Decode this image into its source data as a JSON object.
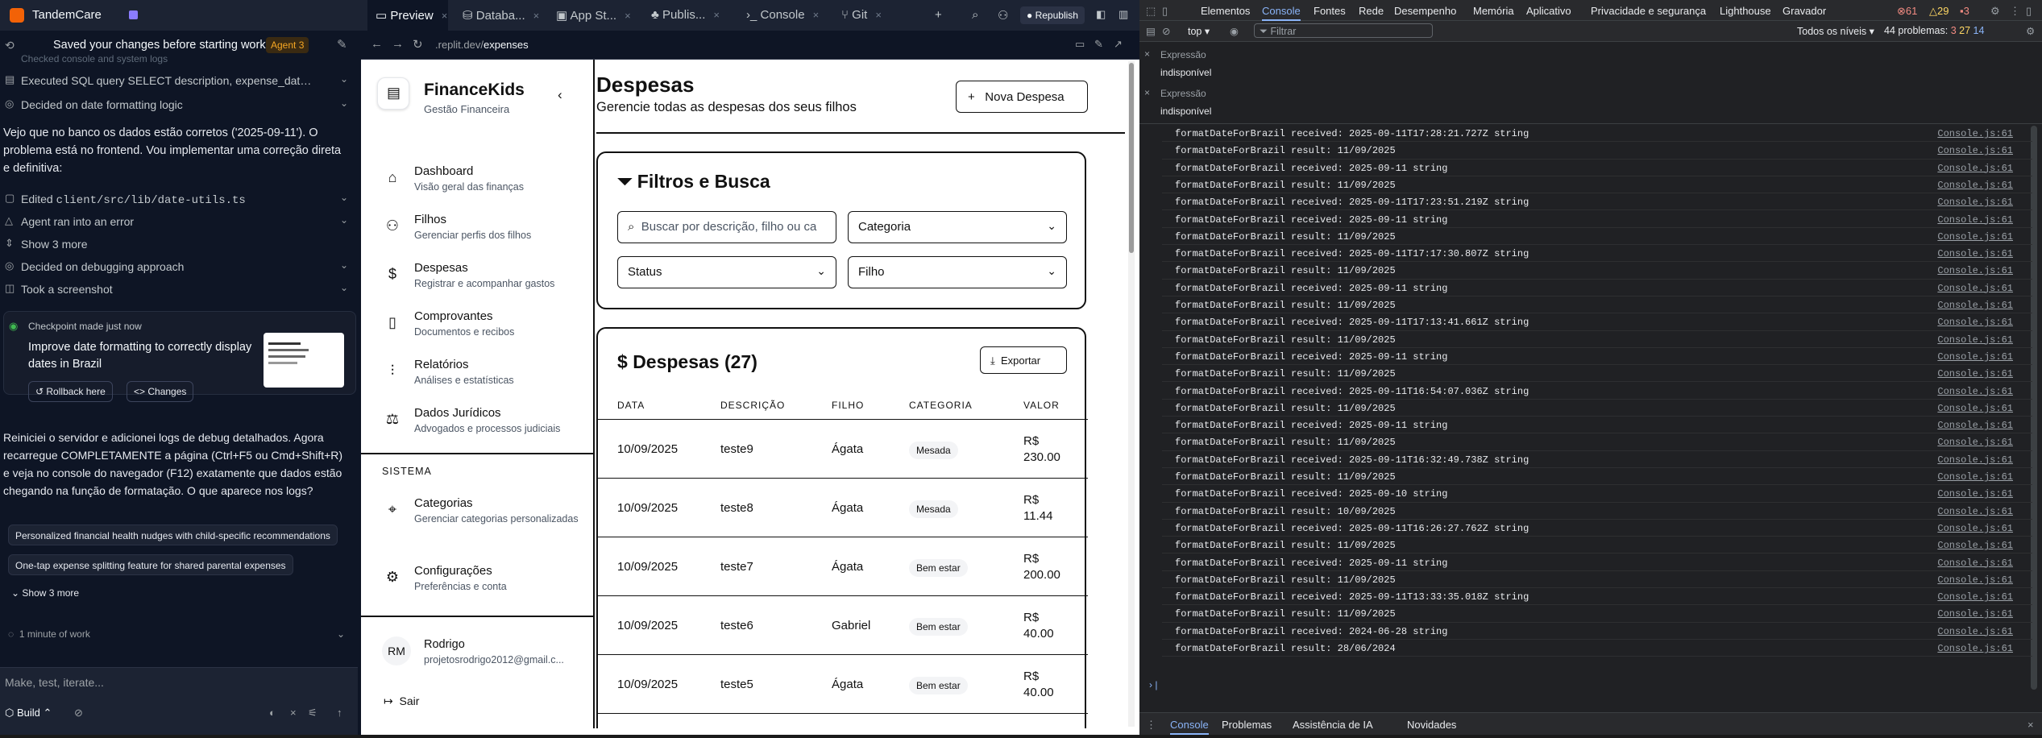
{
  "left_panel": {
    "app_name": "TandemCare",
    "header_title": "Saved your changes before starting work",
    "agent_badge": "Agent 3",
    "truncated_line": "Checked console and system logs",
    "steps": [
      {
        "label": "Executed SQL query SELECT description, expense_dat…"
      },
      {
        "label": "Decided on date formatting logic"
      }
    ],
    "paragraph1": "Vejo que no banco os dados estão corretos ('2025-09-11'). O problema está no frontend. Vou implementar uma correção direta e definitiva:",
    "edited_prefix": "Edited",
    "edited_file": "client/src/lib/date-utils.ts",
    "error_step": "Agent ran into an error",
    "show_more_1": "Show 3 more",
    "step_debug": "Decided on debugging approach",
    "step_screenshot": "Took a screenshot",
    "checkpoint": {
      "status": "Checkpoint made just now",
      "message": "Improve date formatting to correctly display dates in Brazil",
      "rollback": "Rollback here",
      "changes": "Changes"
    },
    "paragraph2": "Reiniciei o servidor e adicionei logs de debug detalhados. Agora recarregue COMPLETAMENTE a página (Ctrl+F5 ou Cmd+Shift+R) e veja no console do navegador (F12) exatamente que dados estão chegando na função de formatação. O que aparece nos logs?",
    "suggestions": [
      "Personalized financial health nudges with child-specific recommendations",
      "One-tap expense splitting feature for shared parental expenses"
    ],
    "show_more_2": "Show 3 more",
    "work_time": "1 minute of work",
    "input_placeholder": "Make, test, iterate...",
    "build_label": "Build"
  },
  "browser": {
    "tabs": [
      {
        "label": "Preview",
        "active": true
      },
      {
        "label": "Databa..."
      },
      {
        "label": "App St..."
      },
      {
        "label": "Publis..."
      },
      {
        "label": "Console"
      },
      {
        "label": "Git"
      }
    ],
    "republish": "Republish",
    "url_prefix": ".replit.dev/",
    "url_path": "expenses"
  },
  "app": {
    "brand": "FinanceKids",
    "brand_sub": "Gestão Financeira",
    "nav": [
      {
        "title": "Dashboard",
        "sub": "Visão geral das finanças",
        "icon": "home-icon"
      },
      {
        "title": "Filhos",
        "sub": "Gerenciar perfis dos filhos",
        "icon": "users-icon"
      },
      {
        "title": "Despesas",
        "sub": "Registrar e acompanhar gastos",
        "icon": "receipt-icon"
      },
      {
        "title": "Comprovantes",
        "sub": "Documentos e recibos",
        "icon": "file-icon"
      },
      {
        "title": "Relatórios",
        "sub": "Análises e estatísticas",
        "icon": "bar-chart-icon"
      },
      {
        "title": "Dados Jurídicos",
        "sub": "Advogados e processos judiciais",
        "icon": "scale-icon"
      }
    ],
    "section_system": "SISTEMA",
    "nav_system": [
      {
        "title": "Categorias",
        "sub": "Gerenciar categorias personalizadas",
        "icon": "tag-icon"
      },
      {
        "title": "Configurações",
        "sub": "Preferências e conta",
        "icon": "gear-icon"
      }
    ],
    "user": {
      "initials": "RM",
      "name": "Rodrigo",
      "email": "projetosrodrigo2012@gmail.c..."
    },
    "logout": "Sair",
    "page_title": "Despesas",
    "page_subtitle": "Gerencie todas as despesas dos seus filhos",
    "new_button": "Nova Despesa",
    "filters_title": "Filtros e Busca",
    "search_placeholder": "Buscar por descrição, filho ou ca",
    "filter_category": "Categoria",
    "filter_status": "Status",
    "filter_child": "Filho",
    "list_title": "Despesas (27)",
    "export_button": "Exportar",
    "columns": [
      "DATA",
      "DESCRIÇÃO",
      "FILHO",
      "CATEGORIA",
      "VALOR"
    ],
    "rows": [
      {
        "date": "10/09/2025",
        "desc": "teste9",
        "child": "Ágata",
        "category": "Mesada",
        "currency": "R$",
        "amount": "230.00"
      },
      {
        "date": "10/09/2025",
        "desc": "teste8",
        "child": "Ágata",
        "category": "Mesada",
        "currency": "R$",
        "amount": "11.44"
      },
      {
        "date": "10/09/2025",
        "desc": "teste7",
        "child": "Ágata",
        "category": "Bem estar",
        "currency": "R$",
        "amount": "200.00"
      },
      {
        "date": "10/09/2025",
        "desc": "teste6",
        "child": "Gabriel",
        "category": "Bem estar",
        "currency": "R$",
        "amount": "40.00"
      },
      {
        "date": "10/09/2025",
        "desc": "teste5",
        "child": "Ágata",
        "category": "Bem estar",
        "currency": "R$",
        "amount": "40.00"
      }
    ]
  },
  "devtools": {
    "tabs": [
      "Elementos",
      "Console",
      "Fontes",
      "Rede",
      "Desempenho",
      "Memória",
      "Aplicativo",
      "Privacidade e segurança",
      "Lighthouse",
      "Gravador"
    ],
    "errors": "61",
    "warnings": "29",
    "info": "3",
    "context": "top",
    "filter_placeholder": "Filtrar",
    "levels": "Todos os níveis",
    "problems": "44 problemas:",
    "problems_counts": [
      "3",
      "27",
      "14"
    ],
    "expressions": [
      {
        "label": "Expressão",
        "value": "indisponível"
      },
      {
        "label": "Expressão",
        "value": "indisponível"
      }
    ],
    "source": "Console.js:61",
    "logs": [
      "formatDateForBrazil received: 2025-09-11T17:28:21.727Z string",
      "formatDateForBrazil result: 11/09/2025",
      "formatDateForBrazil received: 2025-09-11 string",
      "formatDateForBrazil result: 11/09/2025",
      "formatDateForBrazil received: 2025-09-11T17:23:51.219Z string",
      "formatDateForBrazil received: 2025-09-11 string",
      "formatDateForBrazil result: 11/09/2025",
      "formatDateForBrazil received: 2025-09-11T17:17:30.807Z string",
      "formatDateForBrazil result: 11/09/2025",
      "formatDateForBrazil received: 2025-09-11 string",
      "formatDateForBrazil result: 11/09/2025",
      "formatDateForBrazil received: 2025-09-11T17:13:41.661Z string",
      "formatDateForBrazil result: 11/09/2025",
      "formatDateForBrazil received: 2025-09-11 string",
      "formatDateForBrazil result: 11/09/2025",
      "formatDateForBrazil received: 2025-09-11T16:54:07.036Z string",
      "formatDateForBrazil result: 11/09/2025",
      "formatDateForBrazil received: 2025-09-11 string",
      "formatDateForBrazil result: 11/09/2025",
      "formatDateForBrazil received: 2025-09-11T16:32:49.738Z string",
      "formatDateForBrazil result: 11/09/2025",
      "formatDateForBrazil received: 2025-09-10 string",
      "formatDateForBrazil result: 10/09/2025",
      "formatDateForBrazil received: 2025-09-11T16:26:27.762Z string",
      "formatDateForBrazil result: 11/09/2025",
      "formatDateForBrazil received: 2025-09-11 string",
      "formatDateForBrazil result: 11/09/2025",
      "formatDateForBrazil received: 2025-09-11T13:33:35.018Z string",
      "formatDateForBrazil result: 11/09/2025",
      "formatDateForBrazil received: 2024-06-28 string",
      "formatDateForBrazil result: 28/06/2024"
    ],
    "bottom_tabs": [
      "Console",
      "Problemas",
      "Assistência de IA",
      "Novidades"
    ]
  }
}
